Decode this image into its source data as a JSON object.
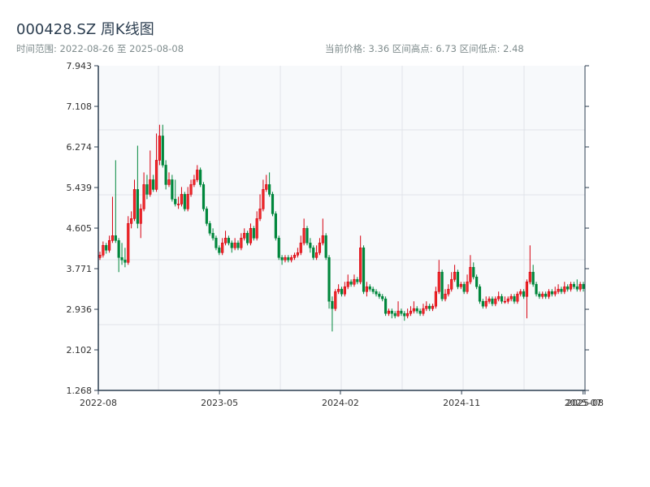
{
  "header": {
    "title": "000428.SZ 周K线图",
    "range": "时间范围: 2022-08-26 至 2025-08-08",
    "stats": "当前价格: 3.36  区间高点: 6.73  区间低点: 2.48"
  },
  "chart_data": {
    "type": "candlestick",
    "title": "000428.SZ 周K线图",
    "frequency": "weekly",
    "start_date": "2022-08-26",
    "end_date": "2025-08-08",
    "ylim": [
      1.268,
      7.943
    ],
    "y_ticks": [
      "1.268",
      "2.102",
      "2.936",
      "3.771",
      "4.605",
      "5.439",
      "6.274",
      "7.108",
      "7.943"
    ],
    "x_ticks": [
      {
        "label": "2022-08",
        "week": 0
      },
      {
        "label": "2023-05",
        "week": 38.6
      },
      {
        "label": "2024-02",
        "week": 77.1
      },
      {
        "label": "2024-11",
        "week": 115.7
      },
      {
        "label": "2025-07",
        "week": 154.4
      },
      {
        "label": "2025-08",
        "week": 155
      }
    ],
    "grid": true,
    "colors": {
      "up": "#d7000f",
      "down": "#00873c",
      "axis": "#2c3e50",
      "grid": "#e1e4ea",
      "background": "#f7f9fb"
    },
    "candle_format": [
      "open",
      "high",
      "low",
      "close"
    ],
    "candles": [
      [
        4.0,
        4.12,
        3.95,
        4.05
      ],
      [
        4.05,
        4.33,
        4.0,
        4.25
      ],
      [
        4.25,
        4.3,
        4.08,
        4.15
      ],
      [
        4.15,
        4.45,
        4.1,
        4.35
      ],
      [
        4.35,
        5.25,
        4.3,
        4.45
      ],
      [
        4.45,
        6.0,
        4.3,
        4.35
      ],
      [
        4.35,
        4.4,
        3.7,
        4.0
      ],
      [
        4.0,
        4.3,
        3.85,
        3.95
      ],
      [
        3.95,
        4.2,
        3.8,
        3.9
      ],
      [
        3.9,
        4.85,
        3.85,
        4.7
      ],
      [
        4.7,
        4.95,
        4.6,
        4.8
      ],
      [
        4.8,
        5.6,
        4.75,
        5.4
      ],
      [
        5.4,
        6.3,
        4.6,
        4.7
      ],
      [
        4.7,
        5.1,
        4.4,
        5.0
      ],
      [
        5.0,
        5.75,
        4.95,
        5.5
      ],
      [
        5.5,
        5.7,
        5.2,
        5.3
      ],
      [
        5.3,
        6.2,
        5.25,
        5.6
      ],
      [
        5.6,
        5.7,
        5.35,
        5.4
      ],
      [
        5.4,
        6.55,
        5.35,
        6.0
      ],
      [
        6.0,
        6.73,
        5.9,
        6.5
      ],
      [
        6.5,
        6.73,
        5.85,
        5.9
      ],
      [
        5.9,
        6.0,
        5.4,
        5.5
      ],
      [
        5.5,
        5.75,
        5.45,
        5.6
      ],
      [
        5.6,
        5.7,
        5.15,
        5.2
      ],
      [
        5.2,
        5.6,
        5.05,
        5.1
      ],
      [
        5.1,
        5.25,
        5.0,
        5.1
      ],
      [
        5.1,
        5.45,
        5.05,
        5.3
      ],
      [
        5.3,
        5.35,
        4.95,
        5.0
      ],
      [
        5.0,
        5.45,
        4.95,
        5.3
      ],
      [
        5.3,
        5.6,
        5.25,
        5.5
      ],
      [
        5.5,
        5.7,
        5.45,
        5.6
      ],
      [
        5.6,
        5.9,
        5.55,
        5.8
      ],
      [
        5.8,
        5.85,
        5.45,
        5.5
      ],
      [
        5.5,
        5.55,
        4.95,
        5.0
      ],
      [
        5.0,
        5.05,
        4.65,
        4.7
      ],
      [
        4.7,
        4.75,
        4.45,
        4.5
      ],
      [
        4.5,
        4.6,
        4.35,
        4.4
      ],
      [
        4.4,
        4.45,
        4.15,
        4.2
      ],
      [
        4.2,
        4.25,
        4.05,
        4.1
      ],
      [
        4.1,
        4.4,
        4.05,
        4.3
      ],
      [
        4.3,
        4.55,
        4.25,
        4.4
      ],
      [
        4.4,
        4.45,
        4.25,
        4.3
      ],
      [
        4.3,
        4.35,
        4.1,
        4.2
      ],
      [
        4.2,
        4.4,
        4.15,
        4.3
      ],
      [
        4.3,
        4.35,
        4.15,
        4.2
      ],
      [
        4.2,
        4.5,
        4.15,
        4.4
      ],
      [
        4.4,
        4.6,
        4.35,
        4.5
      ],
      [
        4.5,
        4.55,
        4.25,
        4.3
      ],
      [
        4.3,
        4.7,
        4.25,
        4.6
      ],
      [
        4.6,
        4.65,
        4.35,
        4.4
      ],
      [
        4.4,
        4.95,
        4.35,
        4.8
      ],
      [
        4.8,
        5.3,
        4.75,
        5.0
      ],
      [
        5.0,
        5.6,
        4.95,
        5.4
      ],
      [
        5.4,
        5.7,
        5.35,
        5.5
      ],
      [
        5.5,
        5.75,
        5.25,
        5.3
      ],
      [
        5.3,
        5.35,
        4.85,
        4.9
      ],
      [
        4.9,
        4.95,
        4.35,
        4.4
      ],
      [
        4.4,
        4.45,
        3.95,
        4.0
      ],
      [
        4.0,
        4.05,
        3.85,
        3.95
      ],
      [
        3.95,
        4.05,
        3.9,
        4.0
      ],
      [
        4.0,
        4.05,
        3.9,
        3.95
      ],
      [
        3.95,
        4.05,
        3.9,
        4.0
      ],
      [
        4.0,
        4.1,
        3.95,
        4.05
      ],
      [
        4.05,
        4.2,
        4.0,
        4.1
      ],
      [
        4.1,
        4.45,
        4.05,
        4.3
      ],
      [
        4.3,
        4.8,
        4.25,
        4.6
      ],
      [
        4.6,
        4.65,
        4.25,
        4.3
      ],
      [
        4.3,
        4.4,
        4.1,
        4.2
      ],
      [
        4.2,
        4.25,
        3.95,
        4.0
      ],
      [
        4.0,
        4.25,
        3.95,
        4.1
      ],
      [
        4.1,
        4.4,
        4.05,
        4.3
      ],
      [
        4.3,
        4.8,
        4.25,
        4.45
      ],
      [
        4.45,
        4.5,
        3.95,
        4.0
      ],
      [
        4.0,
        4.05,
        2.95,
        3.1
      ],
      [
        3.1,
        3.2,
        2.48,
        2.95
      ],
      [
        2.95,
        3.35,
        2.9,
        3.3
      ],
      [
        3.3,
        3.45,
        3.25,
        3.35
      ],
      [
        3.35,
        3.4,
        3.2,
        3.25
      ],
      [
        3.25,
        3.5,
        3.2,
        3.4
      ],
      [
        3.4,
        3.65,
        3.35,
        3.5
      ],
      [
        3.5,
        3.55,
        3.4,
        3.45
      ],
      [
        3.45,
        3.65,
        3.4,
        3.55
      ],
      [
        3.55,
        3.6,
        3.45,
        3.5
      ],
      [
        3.5,
        4.45,
        3.45,
        4.2
      ],
      [
        4.2,
        4.25,
        3.25,
        3.3
      ],
      [
        3.3,
        3.5,
        3.2,
        3.4
      ],
      [
        3.4,
        3.45,
        3.3,
        3.35
      ],
      [
        3.35,
        3.4,
        3.25,
        3.3
      ],
      [
        3.3,
        3.35,
        3.2,
        3.25
      ],
      [
        3.25,
        3.3,
        3.15,
        3.2
      ],
      [
        3.2,
        3.25,
        3.1,
        3.15
      ],
      [
        3.15,
        3.2,
        2.8,
        2.85
      ],
      [
        2.85,
        2.95,
        2.8,
        2.9
      ],
      [
        2.9,
        2.95,
        2.75,
        2.85
      ],
      [
        2.85,
        2.9,
        2.75,
        2.8
      ],
      [
        2.8,
        3.1,
        2.78,
        2.9
      ],
      [
        2.9,
        2.95,
        2.8,
        2.85
      ],
      [
        2.85,
        2.9,
        2.7,
        2.8
      ],
      [
        2.8,
        2.95,
        2.75,
        2.85
      ],
      [
        2.85,
        3.0,
        2.8,
        2.9
      ],
      [
        2.9,
        3.1,
        2.85,
        2.95
      ],
      [
        2.95,
        3.0,
        2.85,
        2.9
      ],
      [
        2.9,
        2.95,
        2.8,
        2.85
      ],
      [
        2.85,
        3.05,
        2.8,
        2.95
      ],
      [
        2.95,
        3.1,
        2.9,
        3.0
      ],
      [
        3.0,
        3.05,
        2.9,
        2.95
      ],
      [
        2.95,
        3.05,
        2.9,
        3.0
      ],
      [
        3.0,
        3.4,
        2.95,
        3.3
      ],
      [
        3.3,
        3.95,
        3.25,
        3.7
      ],
      [
        3.7,
        3.75,
        3.1,
        3.15
      ],
      [
        3.15,
        3.35,
        3.1,
        3.25
      ],
      [
        3.25,
        3.45,
        3.2,
        3.35
      ],
      [
        3.35,
        3.7,
        3.3,
        3.55
      ],
      [
        3.55,
        3.85,
        3.5,
        3.7
      ],
      [
        3.7,
        3.75,
        3.35,
        3.4
      ],
      [
        3.4,
        3.5,
        3.35,
        3.45
      ],
      [
        3.45,
        3.5,
        3.25,
        3.3
      ],
      [
        3.3,
        3.65,
        3.25,
        3.5
      ],
      [
        3.5,
        4.05,
        3.45,
        3.8
      ],
      [
        3.8,
        3.9,
        3.55,
        3.6
      ],
      [
        3.6,
        3.65,
        3.35,
        3.4
      ],
      [
        3.4,
        3.45,
        3.05,
        3.1
      ],
      [
        3.1,
        3.15,
        2.95,
        3.0
      ],
      [
        3.0,
        3.2,
        2.95,
        3.1
      ],
      [
        3.1,
        3.2,
        3.05,
        3.15
      ],
      [
        3.15,
        3.2,
        3.0,
        3.05
      ],
      [
        3.05,
        3.2,
        3.0,
        3.15
      ],
      [
        3.15,
        3.3,
        3.1,
        3.2
      ],
      [
        3.2,
        3.25,
        3.05,
        3.1
      ],
      [
        3.1,
        3.2,
        3.05,
        3.1
      ],
      [
        3.1,
        3.2,
        3.05,
        3.15
      ],
      [
        3.15,
        3.25,
        3.1,
        3.2
      ],
      [
        3.2,
        3.25,
        3.05,
        3.1
      ],
      [
        3.1,
        3.3,
        3.05,
        3.25
      ],
      [
        3.25,
        3.35,
        3.2,
        3.3
      ],
      [
        3.3,
        3.35,
        3.15,
        3.2
      ],
      [
        3.2,
        3.55,
        2.75,
        3.5
      ],
      [
        3.5,
        4.25,
        3.45,
        3.7
      ],
      [
        3.7,
        3.85,
        3.4,
        3.45
      ],
      [
        3.45,
        3.5,
        3.2,
        3.25
      ],
      [
        3.25,
        3.3,
        3.15,
        3.2
      ],
      [
        3.2,
        3.3,
        3.15,
        3.25
      ],
      [
        3.25,
        3.3,
        3.15,
        3.2
      ],
      [
        3.2,
        3.35,
        3.15,
        3.3
      ],
      [
        3.3,
        3.35,
        3.2,
        3.25
      ],
      [
        3.25,
        3.4,
        3.2,
        3.3
      ],
      [
        3.3,
        3.45,
        3.25,
        3.35
      ],
      [
        3.35,
        3.4,
        3.25,
        3.3
      ],
      [
        3.3,
        3.5,
        3.25,
        3.4
      ],
      [
        3.4,
        3.45,
        3.3,
        3.35
      ],
      [
        3.35,
        3.5,
        3.3,
        3.45
      ],
      [
        3.45,
        3.5,
        3.35,
        3.4
      ],
      [
        3.4,
        3.55,
        3.3,
        3.35
      ],
      [
        3.35,
        3.5,
        3.3,
        3.45
      ],
      [
        3.45,
        3.5,
        3.3,
        3.36
      ]
    ]
  }
}
